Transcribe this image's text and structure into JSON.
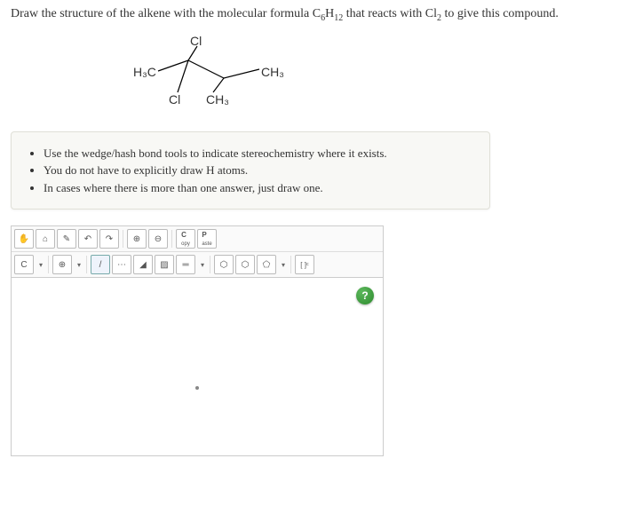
{
  "prompt": {
    "prefix": "Draw the structure of the alkene with the molecular formula C",
    "sub1": "6",
    "mid1": "H",
    "sub2": "12",
    "mid2": " that reacts with Cl",
    "sub3": "2",
    "suffix": " to give this compound."
  },
  "molecule": {
    "cl_top": "Cl",
    "h3c": "H₃C",
    "ch3_right": "CH₃",
    "cl_bl": "Cl",
    "ch3_br": "CH₃"
  },
  "hints": {
    "b1": "Use the wedge/hash bond tools to indicate stereochemistry where it exists.",
    "b2": "You do not have to explicitly draw H atoms.",
    "b3": "In cases where there is more than one answer, just draw one."
  },
  "tools": {
    "hand": "✋",
    "home": "⌂",
    "pencil": "✎",
    "undo": "↶",
    "redo": "↷",
    "zoom_in": "⊕",
    "zoom_out": "⊖",
    "copy_lbl": "C",
    "copy_sub": "opy",
    "paste_lbl": "P",
    "paste_sub": "aste",
    "atom_c": "C",
    "add": "⊕",
    "single": "/",
    "dotted": "⋯",
    "wedge": "◢",
    "hash": "▨",
    "benz": "⬡",
    "cyc6": "⬡",
    "cyc5": "⬠",
    "brackets": "[ ]ᶜ",
    "help": "?"
  }
}
